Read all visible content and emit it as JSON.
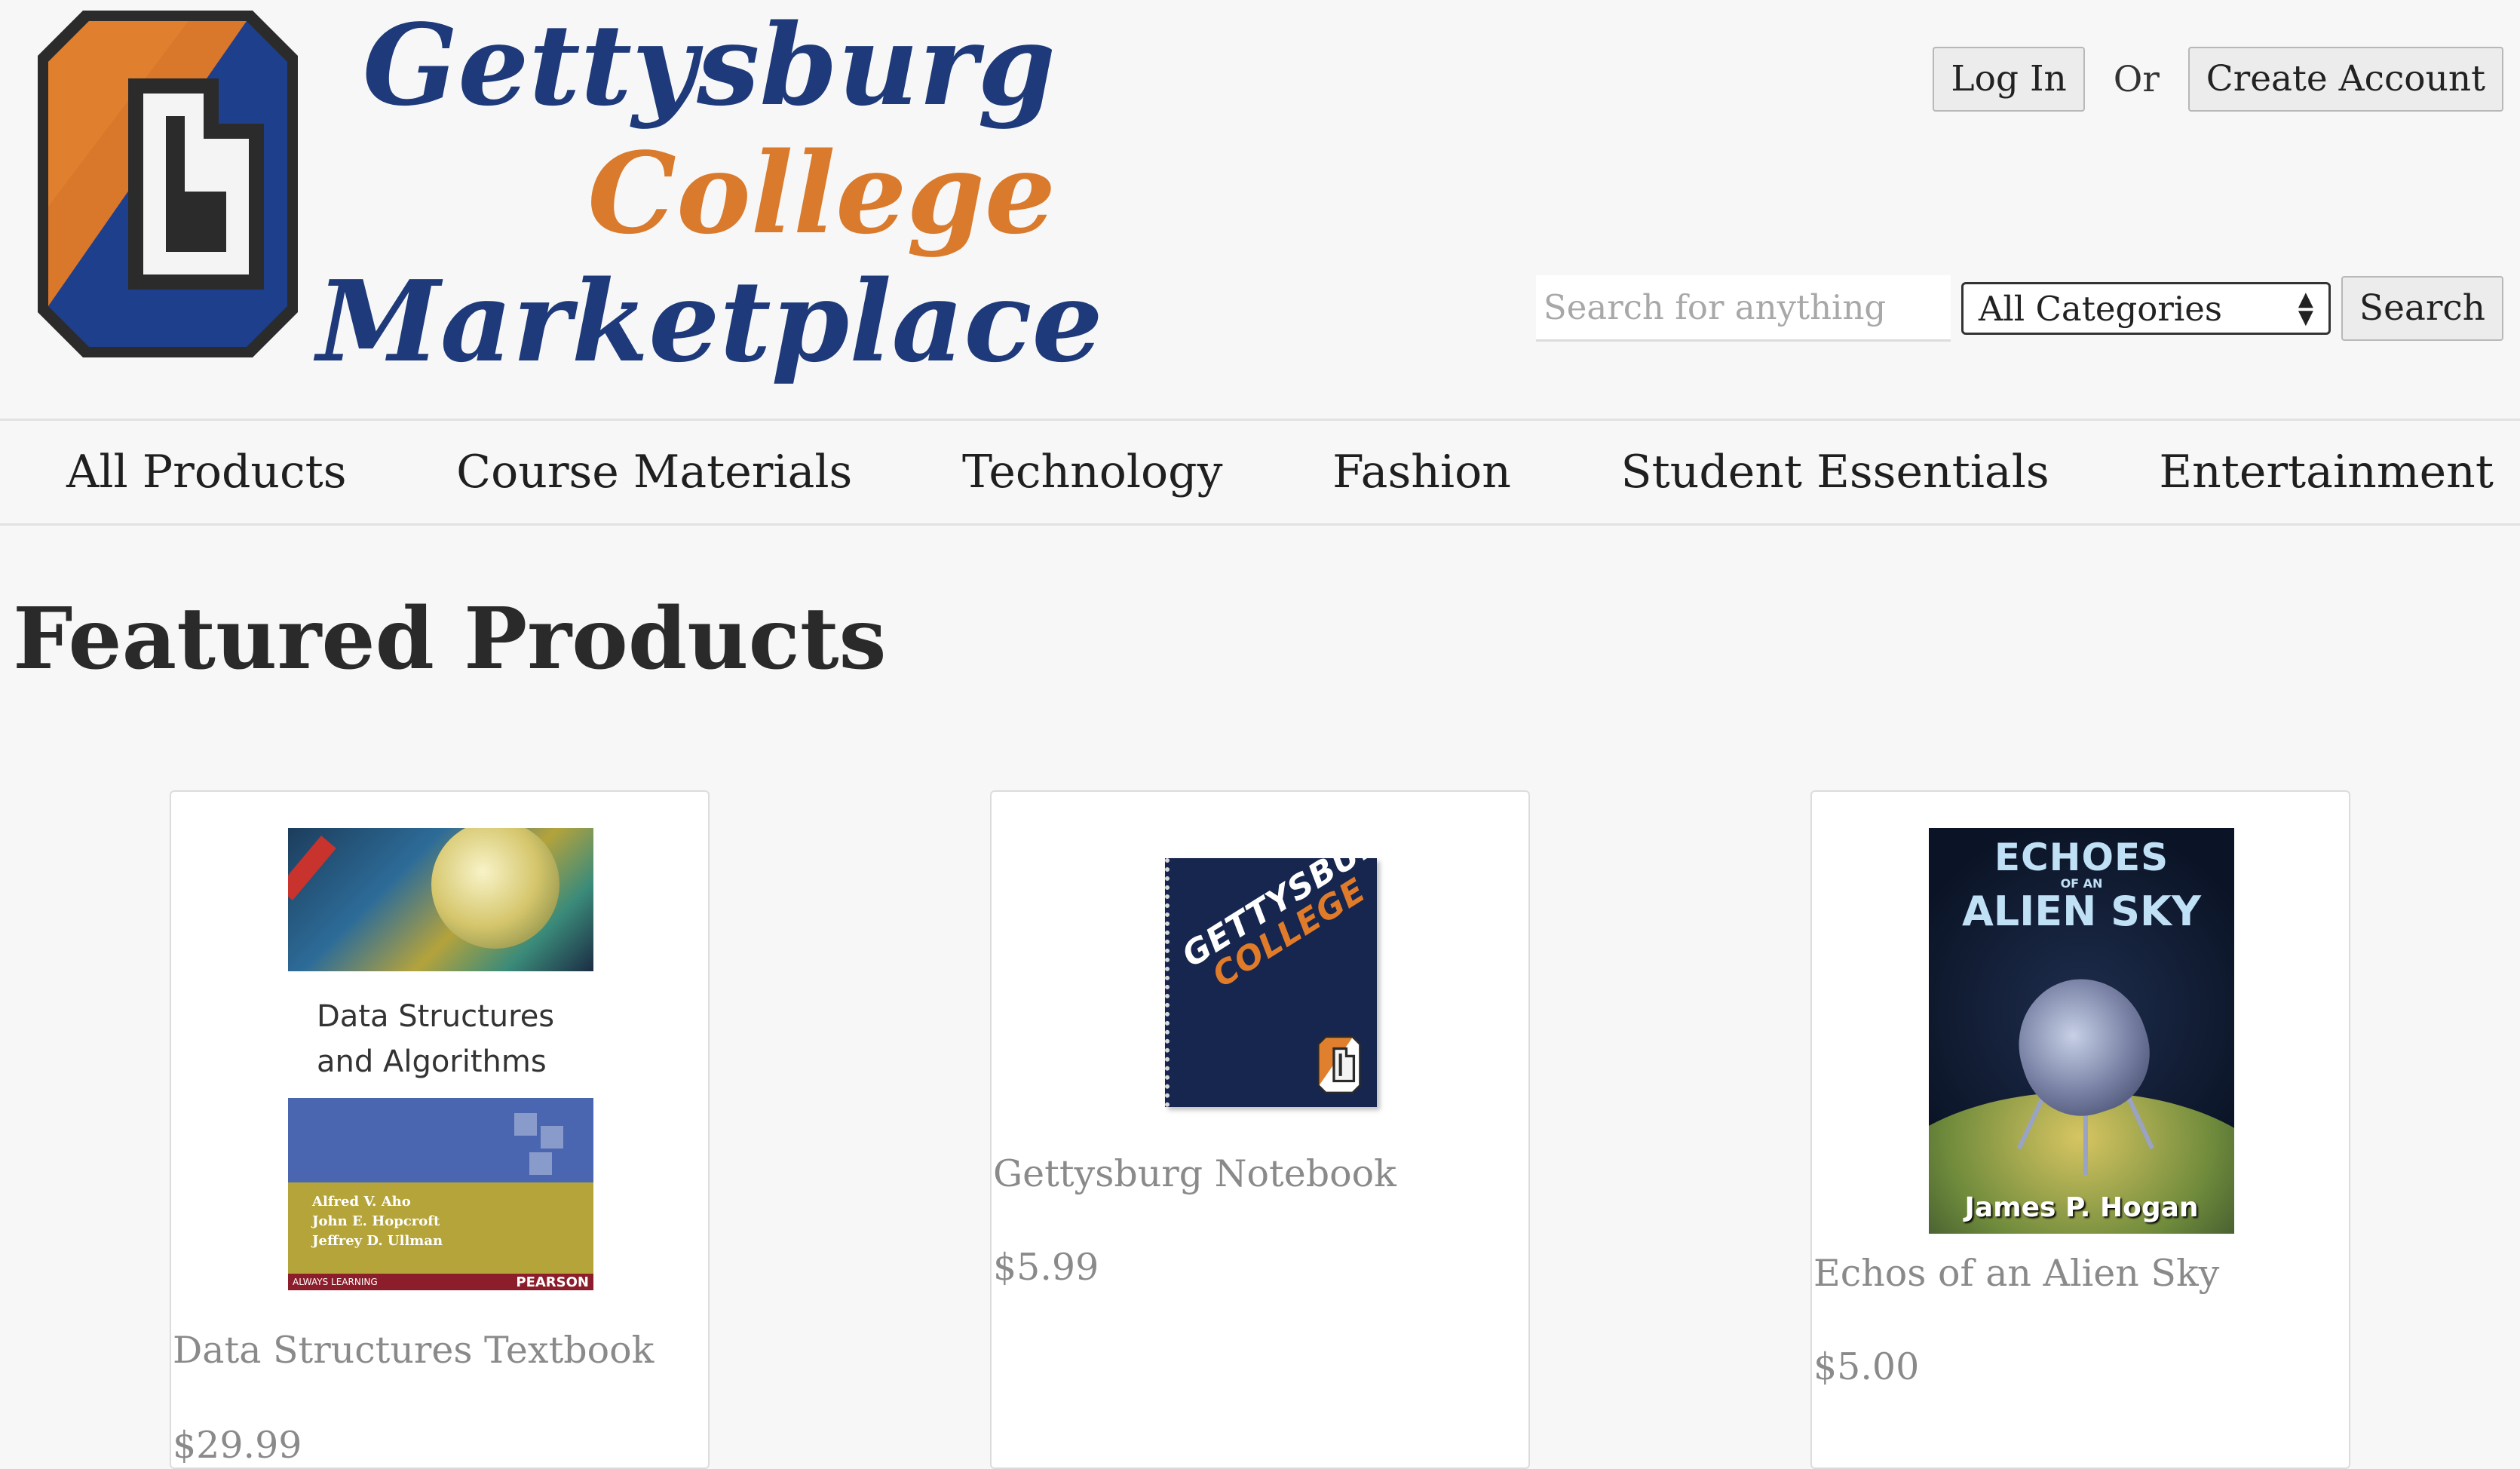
{
  "brand": {
    "line1": "Gettysburg",
    "line2": "College",
    "line3": "Marketplace",
    "colors": {
      "navy": "#1e3a7a",
      "orange": "#d97a2c"
    }
  },
  "auth": {
    "login_label": "Log In",
    "or_text": "Or",
    "create_label": "Create Account"
  },
  "search": {
    "placeholder": "Search for anything",
    "category_selected": "All Categories",
    "button_label": "Search"
  },
  "nav": {
    "items": [
      "All Products",
      "Course Materials",
      "Technology",
      "Fashion",
      "Student Essentials",
      "Entertainment"
    ]
  },
  "main": {
    "title": "Featured Products",
    "products": [
      {
        "name": "Data Structures Textbook",
        "price": "$29.99",
        "cover": {
          "title_line1": "Data Structures",
          "title_line2": "and Algorithms",
          "author1": "Alfred V. Aho",
          "author2": "John E. Hopcroft",
          "author3": "Jeffrey D. Ullman",
          "footer_left": "ALWAYS LEARNING",
          "publisher": "PEARSON"
        }
      },
      {
        "name": "Gettysburg Notebook",
        "price": "$5.99",
        "cover": {
          "line1": "GETTYSBURG",
          "line2": "COLLEGE"
        }
      },
      {
        "name": "Echos of an Alien Sky",
        "price": "$5.00",
        "cover": {
          "title_a": "ECHOES",
          "title_b": "OF AN",
          "title_c": "ALIEN SKY",
          "author": "James P. Hogan"
        }
      }
    ]
  }
}
